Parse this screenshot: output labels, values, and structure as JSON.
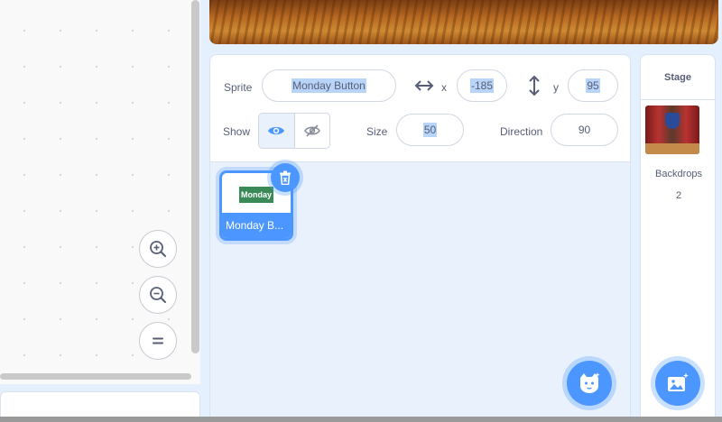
{
  "code_area": {
    "zoom_in_icon": "zoom-in",
    "zoom_out_icon": "zoom-out",
    "reset_zoom_icon": "equals"
  },
  "sprite_info": {
    "sprite_label": "Sprite",
    "sprite_name": "Monday Button",
    "x_label": "x",
    "x_value": "-185",
    "y_label": "y",
    "y_value": "95",
    "show_label": "Show",
    "size_label": "Size",
    "size_value": "50",
    "direction_label": "Direction",
    "direction_value": "90"
  },
  "sprites": [
    {
      "name": "Monday B...",
      "thumb_text": "Monday",
      "selected": true
    }
  ],
  "stage": {
    "header": "Stage",
    "backdrops_label": "Backdrops",
    "backdrops_count": "2"
  },
  "colors": {
    "accent": "#4c97ff",
    "text": "#575e75",
    "badge": "#3a8a58"
  }
}
